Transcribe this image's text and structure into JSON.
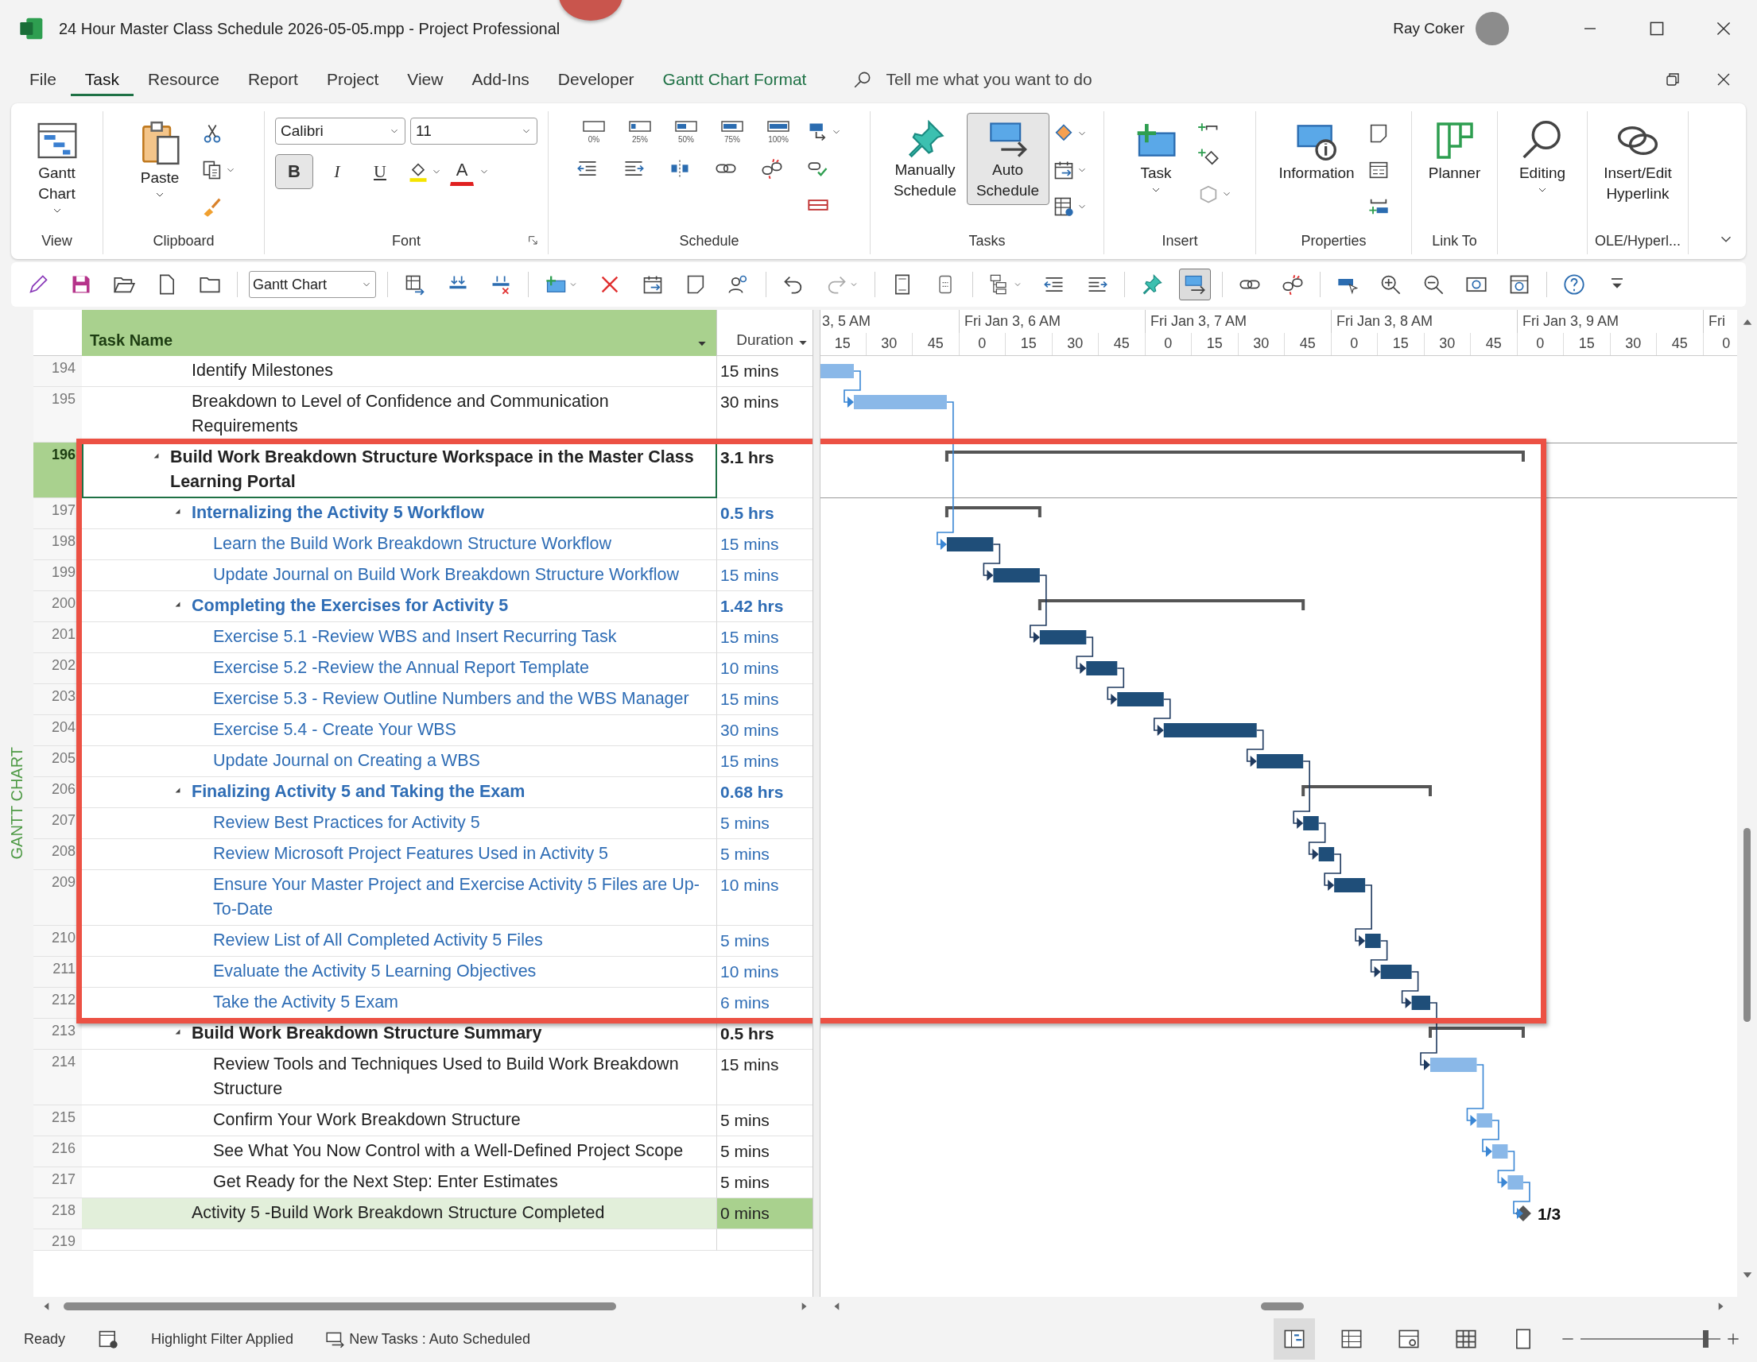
{
  "window": {
    "title": "24 Hour Master Class Schedule 2026-05-05.mpp  -  Project Professional",
    "user": "Ray Coker"
  },
  "menu": [
    {
      "label": "File",
      "selected": false,
      "kind": "plain"
    },
    {
      "label": "Task",
      "selected": true,
      "kind": "plain"
    },
    {
      "label": "Resource",
      "selected": false,
      "kind": "plain"
    },
    {
      "label": "Report",
      "selected": false,
      "kind": "plain"
    },
    {
      "label": "Project",
      "selected": false,
      "kind": "plain"
    },
    {
      "label": "View",
      "selected": false,
      "kind": "plain"
    },
    {
      "label": "Add-Ins",
      "selected": false,
      "kind": "plain"
    },
    {
      "label": "Developer",
      "selected": false,
      "kind": "plain"
    },
    {
      "label": "Gantt Chart Format",
      "selected": false,
      "kind": "contextual"
    }
  ],
  "search": {
    "placeholder": "Tell me what you want to do"
  },
  "ribbon": [
    {
      "label": "View",
      "buttons": [
        {
          "label": "Gantt Chart",
          "selected": false
        }
      ]
    },
    {
      "label": "Clipboard",
      "buttons": [
        {
          "label": "Paste",
          "selected": false
        }
      ]
    },
    {
      "label": "Font",
      "font": "Calibri",
      "size": "11",
      "styles": [
        {
          "kind": "bold",
          "label": "B",
          "selected": true
        },
        {
          "kind": "italic",
          "label": "I",
          "selected": false
        },
        {
          "kind": "underline",
          "label": "U",
          "selected": false
        },
        {
          "kind": "color",
          "label": "A",
          "selected": false
        }
      ]
    },
    {
      "label": "Schedule",
      "percent_buttons": [
        "0%",
        "25%",
        "50%",
        "75%",
        "100%"
      ]
    },
    {
      "label": "Tasks",
      "buttons": [
        {
          "label": "Manually Schedule",
          "selected": false
        },
        {
          "label": "Auto Schedule",
          "selected": true
        }
      ]
    },
    {
      "label": "Insert",
      "buttons": [
        {
          "label": "Task",
          "selected": false
        }
      ]
    },
    {
      "label": "Properties",
      "buttons": [
        {
          "label": "Information",
          "selected": false
        }
      ]
    },
    {
      "label": "Link To",
      "buttons": [
        {
          "label": "Planner",
          "selected": false
        }
      ]
    },
    {
      "buttons": [
        {
          "label": "Editing",
          "selected": false
        }
      ]
    },
    {
      "label": "OLE/Hyperl...",
      "buttons": [
        {
          "label": "Insert/Edit Hyperlink",
          "selected": false
        }
      ]
    }
  ],
  "toolbar": {
    "view_selector": "Gantt Chart",
    "buttons": [
      {
        "selected": false
      },
      {
        "selected": false
      },
      {
        "selected": false
      },
      {
        "selected": false
      },
      {
        "selected": false
      },
      {
        "selected": false
      },
      {
        "selected": false
      },
      {
        "selected": false
      },
      {
        "selected": false
      },
      {
        "selected": false
      },
      {
        "selected": false
      },
      {
        "selected": false
      },
      {
        "selected": false
      },
      {
        "selected": false
      },
      {
        "selected": false
      },
      {
        "selected": false
      },
      {
        "selected": false
      },
      {
        "selected": false
      },
      {
        "selected": false
      },
      {
        "selected": false
      },
      {
        "selected": false
      },
      {
        "selected": true
      },
      {
        "selected": false
      },
      {
        "selected": false
      },
      {
        "selected": false
      },
      {
        "selected": false
      },
      {
        "selected": false
      },
      {
        "selected": false
      },
      {
        "selected": false
      },
      {
        "selected": false
      },
      {
        "selected": false
      }
    ]
  },
  "view_label": "GANTT CHART",
  "columns": [
    "Task Name",
    "Duration"
  ],
  "timescale": {
    "major": [
      "3, 5 AM",
      "Fri Jan 3, 6 AM",
      "Fri Jan 3, 7 AM",
      "Fri Jan 3, 8 AM",
      "Fri Jan 3, 9 AM",
      "Fri"
    ],
    "minor": [
      "15",
      "30",
      "45",
      "0",
      "15",
      "30",
      "45",
      "0",
      "15",
      "30",
      "45",
      "0",
      "15",
      "30",
      "45",
      "0",
      "15",
      "30",
      "45",
      "0"
    ]
  },
  "outline": [
    {
      "kind": "continuation",
      "children": [
        {
          "kind": "task",
          "id": "194",
          "name": "Identify Milestones",
          "duration": "15 mins",
          "highlighted": false,
          "selected": false,
          "shaded": false,
          "framed": false
        },
        {
          "kind": "task",
          "id": "195",
          "name": "Breakdown to Level of Confidence and Communication Requirements",
          "duration": "30 mins",
          "highlighted": false,
          "selected": false,
          "shaded": false,
          "framed": false
        }
      ]
    },
    {
      "kind": "summary",
      "id": "196",
      "name": "Build Work Breakdown Structure Workspace in the Master Class Learning Portal",
      "duration": "3.1 hrs",
      "expanded": true,
      "highlighted": false,
      "selected": true,
      "shaded": false,
      "framed": true,
      "children": [
        {
          "kind": "summary",
          "id": "197",
          "name": "Internalizing the Activity 5 Workflow",
          "duration": "0.5 hrs",
          "expanded": true,
          "highlighted": true,
          "selected": false,
          "shaded": false,
          "framed": true,
          "children": [
            {
              "kind": "task",
              "id": "198",
              "name": "Learn the Build Work Breakdown Structure Workflow",
              "duration": "15 mins",
              "highlighted": true,
              "selected": false,
              "shaded": false,
              "framed": true
            },
            {
              "kind": "task",
              "id": "199",
              "name": "Update Journal on Build Work Breakdown Structure Workflow",
              "duration": "15 mins",
              "highlighted": true,
              "selected": false,
              "shaded": false,
              "framed": true
            }
          ]
        },
        {
          "kind": "summary",
          "id": "200",
          "name": "Completing the Exercises for Activity 5",
          "duration": "1.42 hrs",
          "expanded": true,
          "highlighted": true,
          "selected": false,
          "shaded": false,
          "framed": true,
          "children": [
            {
              "kind": "task",
              "id": "201",
              "name": "Exercise 5.1 -Review WBS and Insert Recurring Task",
              "duration": "15 mins",
              "highlighted": true,
              "selected": false,
              "shaded": false,
              "framed": true
            },
            {
              "kind": "task",
              "id": "202",
              "name": "Exercise 5.2 -Review the Annual Report Template",
              "duration": "10 mins",
              "highlighted": true,
              "selected": false,
              "shaded": false,
              "framed": true
            },
            {
              "kind": "task",
              "id": "203",
              "name": "Exercise 5.3 - Review Outline Numbers and the WBS Manager",
              "duration": "15 mins",
              "highlighted": true,
              "selected": false,
              "shaded": false,
              "framed": true
            },
            {
              "kind": "task",
              "id": "204",
              "name": "Exercise 5.4 - Create Your WBS",
              "duration": "30 mins",
              "highlighted": true,
              "selected": false,
              "shaded": false,
              "framed": true
            },
            {
              "kind": "task",
              "id": "205",
              "name": "Update Journal on Creating a WBS",
              "duration": "15 mins",
              "highlighted": true,
              "selected": false,
              "shaded": false,
              "framed": true
            }
          ]
        },
        {
          "kind": "summary",
          "id": "206",
          "name": "Finalizing Activity 5 and Taking the Exam",
          "duration": "0.68 hrs",
          "expanded": true,
          "highlighted": true,
          "selected": false,
          "shaded": false,
          "framed": true,
          "children": [
            {
              "kind": "task",
              "id": "207",
              "name": "Review Best Practices for Activity 5",
              "duration": "5 mins",
              "highlighted": true,
              "selected": false,
              "shaded": false,
              "framed": true
            },
            {
              "kind": "task",
              "id": "208",
              "name": "Review Microsoft Project Features Used in Activity 5",
              "duration": "5 mins",
              "highlighted": true,
              "selected": false,
              "shaded": false,
              "framed": true
            },
            {
              "kind": "task",
              "id": "209",
              "name": "Ensure Your Master Project and Exercise Activity 5 Files are Up-To-Date",
              "duration": "10 mins",
              "highlighted": true,
              "selected": false,
              "shaded": false,
              "framed": true
            },
            {
              "kind": "task",
              "id": "210",
              "name": "Review List of All Completed Activity 5 Files",
              "duration": "5 mins",
              "highlighted": true,
              "selected": false,
              "shaded": false,
              "framed": true
            },
            {
              "kind": "task",
              "id": "211",
              "name": "Evaluate the Activity 5 Learning Objectives",
              "duration": "10 mins",
              "highlighted": true,
              "selected": false,
              "shaded": false,
              "framed": true
            },
            {
              "kind": "task",
              "id": "212",
              "name": "Take the Activity 5 Exam",
              "duration": "6 mins",
              "highlighted": true,
              "selected": false,
              "shaded": false,
              "framed": true
            }
          ]
        },
        {
          "kind": "summary",
          "id": "213",
          "name": "Build Work Breakdown Structure Summary",
          "duration": "0.5 hrs",
          "expanded": true,
          "highlighted": false,
          "selected": false,
          "shaded": false,
          "framed": false,
          "children": [
            {
              "kind": "task",
              "id": "214",
              "name": "Review Tools and Techniques Used to Build Work Breakdown Structure",
              "duration": "15 mins",
              "highlighted": false,
              "selected": false,
              "shaded": false,
              "framed": false
            },
            {
              "kind": "task",
              "id": "215",
              "name": "Confirm Your Work Breakdown Structure",
              "duration": "5 mins",
              "highlighted": false,
              "selected": false,
              "shaded": false,
              "framed": false
            },
            {
              "kind": "task",
              "id": "216",
              "name": "See What You Now Control with a Well-Defined Project Scope",
              "duration": "5 mins",
              "highlighted": false,
              "selected": false,
              "shaded": false,
              "framed": false
            },
            {
              "kind": "task",
              "id": "217",
              "name": "Get Ready for the Next Step: Enter Estimates",
              "duration": "5 mins",
              "highlighted": false,
              "selected": false,
              "shaded": false,
              "framed": false
            }
          ]
        },
        {
          "kind": "milestone",
          "id": "218",
          "name": "Activity 5 -Build Work Breakdown Structure Completed",
          "duration": "0 mins",
          "bar_label": "1/3",
          "highlighted": false,
          "selected": false,
          "shaded": true,
          "framed": false
        }
      ]
    },
    {
      "kind": "task",
      "id": "219",
      "highlighted": false,
      "selected": false,
      "shaded": false,
      "framed": false
    }
  ],
  "status_bar": {
    "mode": "Ready",
    "filter": "Highlight Filter Applied",
    "new_tasks": "New Tasks : Auto Scheduled",
    "views": [
      {
        "selected": true
      },
      {
        "selected": false
      },
      {
        "selected": false
      },
      {
        "selected": false
      },
      {
        "selected": false
      }
    ],
    "zoom": {
      "level": 0.9
    }
  }
}
